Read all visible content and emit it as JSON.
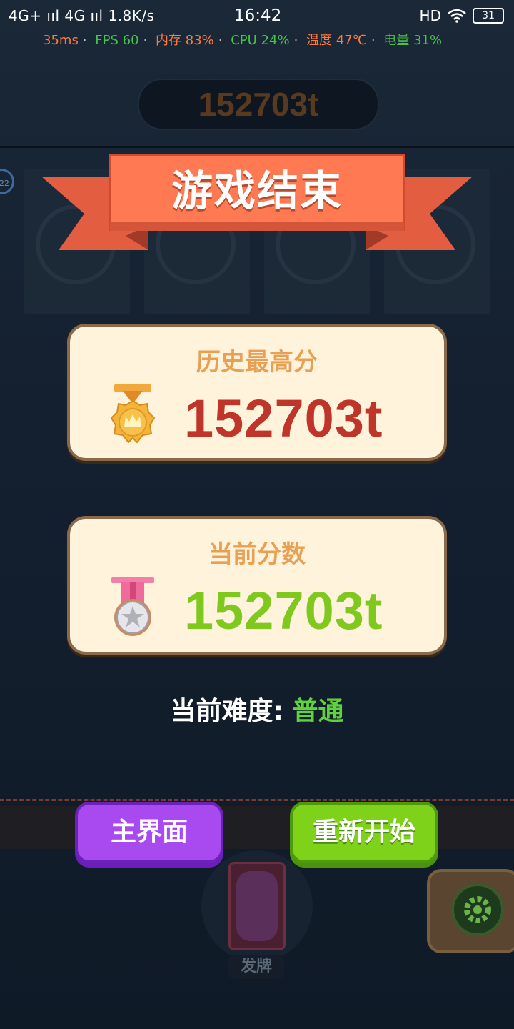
{
  "status_bar": {
    "left": "4G+ ııl 4G ııl 1.8K/s",
    "time": "16:42",
    "right": "HD",
    "battery": "31"
  },
  "perf_overlay": {
    "latency": "35ms",
    "fps": "FPS 60",
    "memory": "内存 83%",
    "cpu": "CPU 24%",
    "temp": "温度 47℃",
    "power": "电量 31%"
  },
  "top_score": "152703t",
  "slot_badge": "22",
  "title": "游戏结束",
  "best": {
    "label": "历史最高分",
    "value": "152703t",
    "value_color": "#c0352a"
  },
  "current": {
    "label": "当前分数",
    "value": "152703t",
    "value_color": "#7fc81e"
  },
  "difficulty": {
    "label": "当前难度:",
    "value": "普通"
  },
  "buttons": {
    "home": "主界面",
    "restart": "重新开始"
  },
  "deal": {
    "label": "发牌"
  },
  "icons": [
    "signal-icon",
    "wifi-icon",
    "battery-icon",
    "gold-crown-medal-icon",
    "silver-star-medal-icon",
    "gear-icon",
    "card-back-icon"
  ]
}
